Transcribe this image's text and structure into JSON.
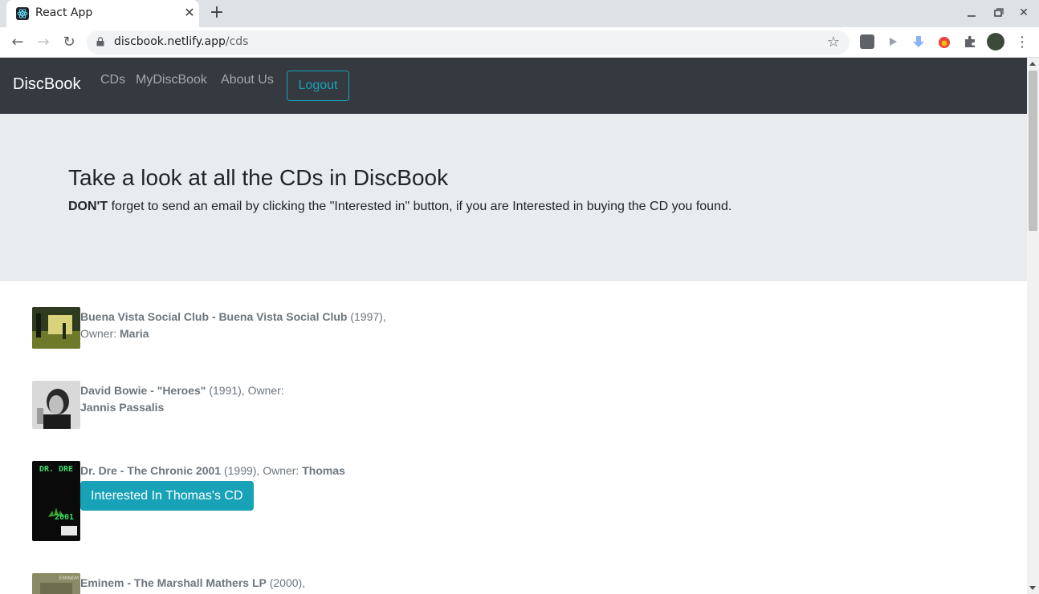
{
  "browser": {
    "tab_title": "React App",
    "url_host": "discbook.netlify.app",
    "url_path": "/cds"
  },
  "navbar": {
    "brand": "DiscBook",
    "links": [
      "CDs",
      "MyDiscBook",
      "About Us"
    ],
    "logout": "Logout"
  },
  "jumbotron": {
    "title": "Take a look at all the CDs in DiscBook",
    "text_bold": "DON'T",
    "text_rest": "forget to send an email by clicking the \"Interested in\" button, if you are Interested in buying the CD you found."
  },
  "cds": [
    {
      "title": "Buena Vista Social Club - Buena Vista Social Club",
      "year": "(1997),",
      "owner_label": "Owner:",
      "owner": "Maria"
    },
    {
      "title": "David Bowie - \"Heroes\"",
      "year": "(1991), Owner:",
      "owner_label": "",
      "owner": "Jannis Passalis"
    },
    {
      "title": "Dr. Dre - The Chronic 2001",
      "year": "(1999), Owner:",
      "owner_label": "",
      "owner": "Thomas",
      "button": "Interested In Thomas's CD",
      "cover_text_top": "DR. DRE",
      "cover_text_bottom": "2001"
    },
    {
      "title": "Eminem - The Marshall Mathers LP",
      "year": "(2000),",
      "owner_label": "",
      "owner": "",
      "cover_text_top": "EMINEM"
    }
  ],
  "colors": {
    "navbar_bg": "#343a40",
    "accent": "#17a2b8",
    "jumbotron_bg": "#e9ecef",
    "muted_text": "#6c757d"
  }
}
